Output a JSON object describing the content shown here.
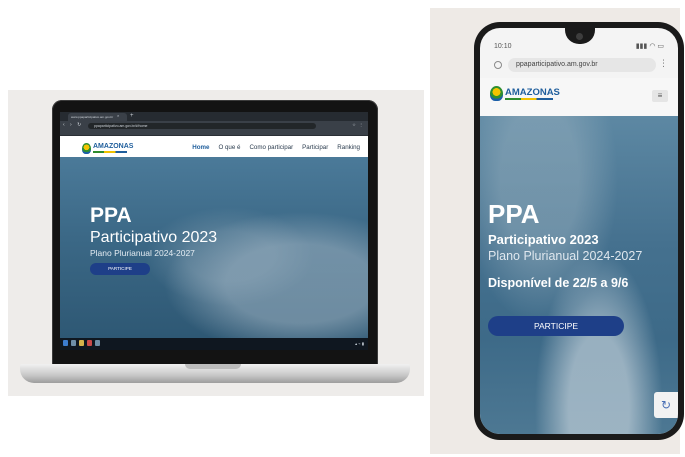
{
  "laptop": {
    "browser": {
      "tab_title": "www.ppaparticipativo.am.gov.br",
      "url": "ppaparticipativo.am.gov.br/#/home"
    },
    "site": {
      "logo_text": "AMAZONAS",
      "nav": [
        "Home",
        "O que é",
        "Como participar",
        "Participar",
        "Ranking"
      ],
      "hero": {
        "title": "PPA",
        "subtitle": "Participativo 2023",
        "plan": "Plano Plurianual 2024-2027",
        "button": "PARTICIPE"
      }
    }
  },
  "phone": {
    "status_time": "10:10",
    "status_icons": "▮▮▮ ◠ ▭",
    "url": "ppaparticipativo.am.gov.br",
    "logo_text": "AMAZONAS",
    "hero": {
      "title": "PPA",
      "subtitle": "Participativo 2023",
      "plan": "Plano Plurianual 2024-2027",
      "availability": "Disponível de 22/5 a 9/6",
      "button": "PARTICIPE"
    }
  },
  "colors": {
    "brand_blue": "#1f5e9c",
    "button_blue": "#1e3f88",
    "hero_blue": "#45718f"
  }
}
